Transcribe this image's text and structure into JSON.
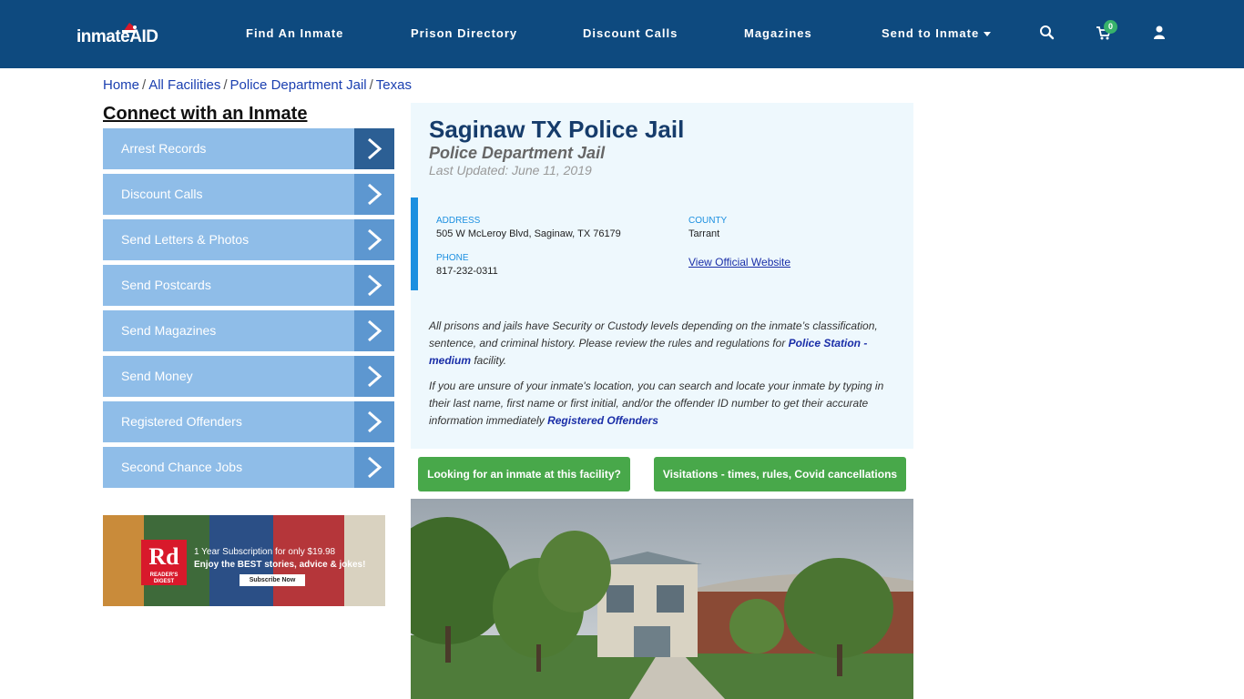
{
  "header": {
    "logo_text": "inmateAID",
    "nav": [
      {
        "label": "Find An Inmate"
      },
      {
        "label": "Prison Directory"
      },
      {
        "label": "Discount Calls"
      },
      {
        "label": "Magazines"
      },
      {
        "label": "Send to Inmate"
      }
    ],
    "cart_count": "0",
    "icons": [
      "search-icon",
      "cart-icon",
      "user-icon"
    ],
    "bg_color": "#0e4a7f"
  },
  "breadcrumb": [
    "Home",
    "All Facilities",
    "Police Department Jail",
    "Texas"
  ],
  "sidebar": {
    "title": "Connect with an Inmate",
    "items": [
      {
        "label": "Arrest Records"
      },
      {
        "label": "Discount Calls"
      },
      {
        "label": "Send Letters & Photos"
      },
      {
        "label": "Send Postcards"
      },
      {
        "label": "Send Magazines"
      },
      {
        "label": "Send Money"
      },
      {
        "label": "Registered Offenders"
      },
      {
        "label": "Second Chance Jobs"
      }
    ]
  },
  "ad": {
    "logo": "Rd",
    "logo_sub": "READER'S DIGEST",
    "line1": "1 Year Subscription for only $19.98",
    "line2": "Enjoy the BEST stories, advice & jokes!",
    "cta": "Subscribe Now"
  },
  "facility": {
    "title": "Saginaw TX Police Jail",
    "type": "Police Department Jail",
    "updated": "Last Updated: June 11, 2019",
    "address_label": "ADDRESS",
    "address": "505 W McLeroy Blvd, Saginaw, TX 76179",
    "county_label": "COUNTY",
    "county": "Tarrant",
    "phone_label": "PHONE",
    "phone": "817-232-0311",
    "website_link": "View Official Website",
    "para1_text": "All prisons and jails have Security or Custody levels depending on the inmate’s classification, sentence, and criminal history. Please review the rules and regulations for ",
    "para1_link": "Police Station - medium",
    "para1_end": " facility.",
    "para2_text": "If you are unsure of your inmate's location, you can search and locate your inmate by typing in their last name, first name or first initial, and/or the offender ID number to get their accurate information immediately ",
    "para2_link": "Registered Offenders"
  },
  "buttons": {
    "lookup": "Looking for an inmate at this facility?",
    "visitation": "Visitations - times, rules, Covid cancellations"
  },
  "colors": {
    "accent_blue": "#1b8fe0",
    "button_green": "#48a84a",
    "sidebar_item": "#8fbde8",
    "title_navy": "#163c6b"
  }
}
